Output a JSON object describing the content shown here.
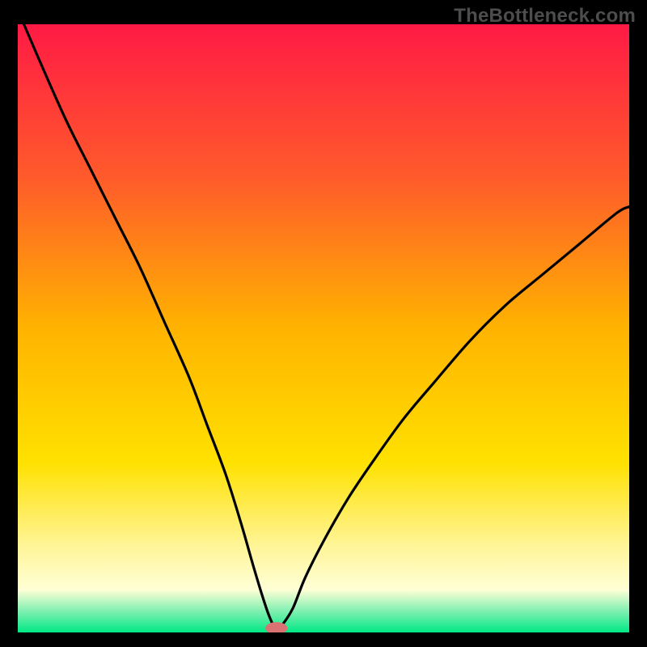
{
  "watermark": "TheBottleneck.com",
  "colors": {
    "black": "#000000",
    "curve": "#000000",
    "marker": "#d97373",
    "gradient_stops": [
      {
        "offset": 0.0,
        "color": "#ff1a45"
      },
      {
        "offset": 0.25,
        "color": "#ff5a2b"
      },
      {
        "offset": 0.5,
        "color": "#ffb300"
      },
      {
        "offset": 0.72,
        "color": "#ffe100"
      },
      {
        "offset": 0.86,
        "color": "#fff59a"
      },
      {
        "offset": 0.93,
        "color": "#ffffd6"
      },
      {
        "offset": 0.965,
        "color": "#7ff0b0"
      },
      {
        "offset": 1.0,
        "color": "#00e884"
      }
    ]
  },
  "chart_data": {
    "type": "line",
    "title": "",
    "xlabel": "",
    "ylabel": "",
    "xlim": [
      0,
      100
    ],
    "ylim": [
      0,
      100
    ],
    "grid": false,
    "legend": false,
    "series": [
      {
        "name": "bottleneck-curve",
        "x": [
          1,
          4,
          8,
          12,
          16,
          20,
          24,
          28,
          31,
          34,
          36.5,
          38.5,
          40,
          41,
          41.8,
          42.5,
          43.3,
          45,
          47,
          50,
          54,
          58,
          63,
          68,
          74,
          80,
          86,
          92,
          98,
          100
        ],
        "values": [
          100,
          93,
          84,
          76,
          68,
          60,
          51,
          42,
          34,
          26,
          18,
          11,
          6,
          3,
          1.2,
          0.6,
          1.3,
          4,
          9,
          15,
          22,
          28,
          35,
          41,
          48,
          54,
          59,
          64,
          69,
          70
        ]
      }
    ],
    "marker": {
      "x": 42.3,
      "y": 0.7,
      "rx": 1.8,
      "ry": 1.0
    }
  }
}
